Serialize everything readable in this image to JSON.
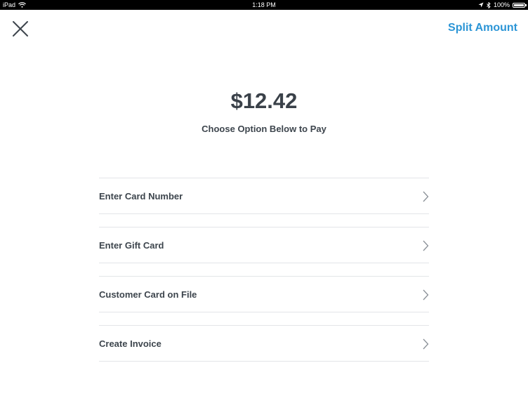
{
  "status_bar": {
    "device": "iPad",
    "time": "1:18 PM",
    "battery": "100%"
  },
  "header": {
    "close_icon": "close-icon",
    "split_label": "Split Amount"
  },
  "payment": {
    "amount": "$12.42",
    "prompt": "Choose Option Below to Pay"
  },
  "options": [
    {
      "label": "Enter Card Number",
      "icon": "chevron-right-icon"
    },
    {
      "label": "Enter Gift Card",
      "icon": "chevron-right-icon"
    },
    {
      "label": "Customer Card on File",
      "icon": "chevron-right-icon"
    },
    {
      "label": "Create Invoice",
      "icon": "chevron-right-icon"
    }
  ],
  "colors": {
    "accent": "#2b95d6",
    "text": "#3d454d",
    "divider": "#e3e5e8"
  }
}
